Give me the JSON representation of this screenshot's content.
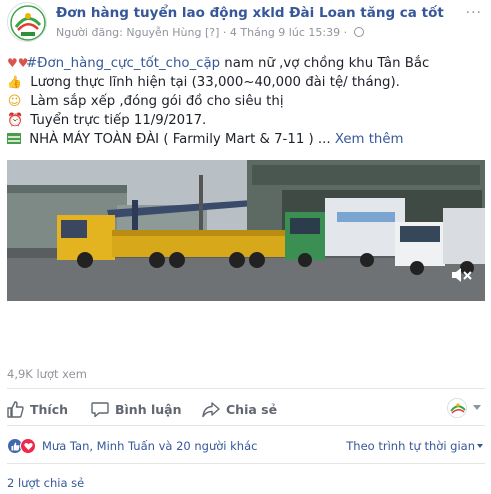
{
  "page": {
    "title": "Đơn hàng tuyển lao động xkld Đài Loan tăng ca tốt",
    "poster_prefix": "Người đăng:",
    "poster_name": "Nguyễn Hùng",
    "poster_tag": "[?]",
    "timestamp": "4 Tháng 9 lúc 15:39",
    "more_options": "···"
  },
  "post": {
    "lines": [
      {
        "icon": "couple-icon",
        "hashtag": "#Đơn_hàng_cực_tốt_cho_cặp",
        "text": " nam nữ ,vợ chồng khu Tân Bắc"
      },
      {
        "icon": "thumb-money-icon",
        "text": " Lương thực lĩnh hiện tại (33,000~40,000 đài tệ/ tháng)."
      },
      {
        "icon": "smile-icon",
        "text": " Làm sắp xếp ,đóng gói đồ cho siêu thị"
      },
      {
        "icon": "alarm-clock-icon",
        "text": " Tuyển trực tiếp 11/9/2017."
      },
      {
        "icon": "bar-chart-icon",
        "text": " NHÀ MÁY TOÀN ĐÀI ( Farmily Mart & 7-11 ) ..."
      }
    ],
    "see_more": "Xem thêm"
  },
  "video": {
    "mute_icon": "speaker-muted-icon"
  },
  "stats": {
    "views": "4,9K lượt xem"
  },
  "actions": {
    "like": "Thích",
    "comment": "Bình luận",
    "share": "Chia sẻ"
  },
  "reactions": {
    "summary": "Mưa Tan, Minh Tuấn và 20 người khác",
    "sort_label": "Theo trình tự thời gian"
  },
  "shares": {
    "count_text": "2 lượt chia sẻ"
  },
  "colors": {
    "link": "#365899",
    "muted": "#90949c",
    "like_blue": "#4267b2",
    "love_red": "#f0284a"
  }
}
